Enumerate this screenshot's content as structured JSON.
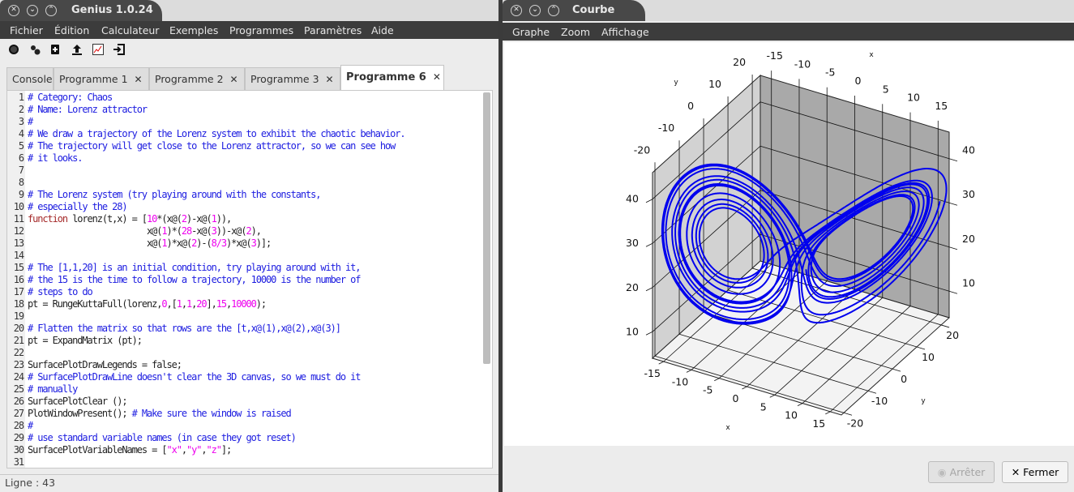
{
  "main_window": {
    "title": "Genius 1.0.24",
    "menu": [
      "Fichier",
      "Édition",
      "Calculateur",
      "Exemples",
      "Programmes",
      "Paramètres",
      "Aide"
    ],
    "toolbar_icons": [
      "stop-icon",
      "run-icon",
      "new-file-icon",
      "upload-icon",
      "plot-icon",
      "exit-icon"
    ],
    "tabs": [
      {
        "label": "Console",
        "closable": false
      },
      {
        "label": "Programme 1",
        "closable": true
      },
      {
        "label": "Programme 2",
        "closable": true
      },
      {
        "label": "Programme 3",
        "closable": true
      },
      {
        "label": "Programme 6",
        "closable": true,
        "active": true
      }
    ],
    "close_glyph": "✕",
    "status": "Ligne : 43"
  },
  "editor": {
    "colors": {
      "comment": "#1c1ce0",
      "keyword": "#a52a2a",
      "number": "#ee00ee",
      "string": "#ee00ee"
    },
    "lines": [
      {
        "n": "1",
        "segs": [
          {
            "k": "c",
            "v": "# Category: Chaos"
          }
        ]
      },
      {
        "n": "2",
        "segs": [
          {
            "k": "c",
            "v": "# Name: Lorenz attractor"
          }
        ]
      },
      {
        "n": "3",
        "segs": [
          {
            "k": "c",
            "v": "#"
          }
        ]
      },
      {
        "n": "4",
        "segs": [
          {
            "k": "c",
            "v": "# We draw a trajectory of the Lorenz system to exhibit the chaotic behavior."
          }
        ]
      },
      {
        "n": "5",
        "segs": [
          {
            "k": "c",
            "v": "# The trajectory will get close to the Lorenz attractor, so we can see how"
          }
        ]
      },
      {
        "n": "6",
        "segs": [
          {
            "k": "c",
            "v": "# it looks."
          }
        ]
      },
      {
        "n": "7",
        "segs": []
      },
      {
        "n": "8",
        "segs": []
      },
      {
        "n": "9",
        "segs": [
          {
            "k": "c",
            "v": "# The Lorenz system (try playing around with the constants,"
          }
        ]
      },
      {
        "n": "10",
        "segs": [
          {
            "k": "c",
            "v": "# especially the 28)"
          }
        ]
      },
      {
        "n": "11",
        "segs": [
          {
            "k": "k",
            "v": "function"
          },
          {
            "k": "t",
            "v": " lorenz(t,x) = ["
          },
          {
            "k": "n",
            "v": "10"
          },
          {
            "k": "t",
            "v": "*(x@("
          },
          {
            "k": "n",
            "v": "2"
          },
          {
            "k": "t",
            "v": ")-x@("
          },
          {
            "k": "n",
            "v": "1"
          },
          {
            "k": "t",
            "v": ")),"
          }
        ]
      },
      {
        "n": "12",
        "segs": [
          {
            "k": "t",
            "v": "                        x@("
          },
          {
            "k": "n",
            "v": "1"
          },
          {
            "k": "t",
            "v": ")*("
          },
          {
            "k": "n",
            "v": "28"
          },
          {
            "k": "t",
            "v": "-x@("
          },
          {
            "k": "n",
            "v": "3"
          },
          {
            "k": "t",
            "v": "))-x@("
          },
          {
            "k": "n",
            "v": "2"
          },
          {
            "k": "t",
            "v": "),"
          }
        ]
      },
      {
        "n": "13",
        "segs": [
          {
            "k": "t",
            "v": "                        x@("
          },
          {
            "k": "n",
            "v": "1"
          },
          {
            "k": "t",
            "v": ")*x@("
          },
          {
            "k": "n",
            "v": "2"
          },
          {
            "k": "t",
            "v": ")-("
          },
          {
            "k": "n",
            "v": "8/3"
          },
          {
            "k": "t",
            "v": ")*x@("
          },
          {
            "k": "n",
            "v": "3"
          },
          {
            "k": "t",
            "v": ")];"
          }
        ]
      },
      {
        "n": "14",
        "segs": []
      },
      {
        "n": "15",
        "segs": [
          {
            "k": "c",
            "v": "# The [1,1,20] is an initial condition, try playing around with it,"
          }
        ]
      },
      {
        "n": "16",
        "segs": [
          {
            "k": "c",
            "v": "# the 15 is the time to follow a trajectory, 10000 is the number of"
          }
        ]
      },
      {
        "n": "17",
        "segs": [
          {
            "k": "c",
            "v": "# steps to do"
          }
        ]
      },
      {
        "n": "18",
        "segs": [
          {
            "k": "t",
            "v": "pt = RungeKuttaFull(lorenz,"
          },
          {
            "k": "n",
            "v": "0"
          },
          {
            "k": "t",
            "v": ",["
          },
          {
            "k": "n",
            "v": "1"
          },
          {
            "k": "t",
            "v": ","
          },
          {
            "k": "n",
            "v": "1"
          },
          {
            "k": "t",
            "v": ","
          },
          {
            "k": "n",
            "v": "20"
          },
          {
            "k": "t",
            "v": "],"
          },
          {
            "k": "n",
            "v": "15"
          },
          {
            "k": "t",
            "v": ","
          },
          {
            "k": "n",
            "v": "10000"
          },
          {
            "k": "t",
            "v": ");"
          }
        ]
      },
      {
        "n": "19",
        "segs": []
      },
      {
        "n": "20",
        "segs": [
          {
            "k": "c",
            "v": "# Flatten the matrix so that rows are the [t,x@(1),x@(2),x@(3)]"
          }
        ]
      },
      {
        "n": "21",
        "segs": [
          {
            "k": "t",
            "v": "pt = ExpandMatrix (pt);"
          }
        ]
      },
      {
        "n": "22",
        "segs": []
      },
      {
        "n": "23",
        "segs": [
          {
            "k": "t",
            "v": "SurfacePlotDrawLegends = false;"
          }
        ]
      },
      {
        "n": "24",
        "segs": [
          {
            "k": "c",
            "v": "# SurfacePlotDrawLine doesn't clear the 3D canvas, so we must do it"
          }
        ]
      },
      {
        "n": "25",
        "segs": [
          {
            "k": "c",
            "v": "# manually"
          }
        ]
      },
      {
        "n": "26",
        "segs": [
          {
            "k": "t",
            "v": "SurfacePlotClear ();"
          }
        ]
      },
      {
        "n": "27",
        "segs": [
          {
            "k": "t",
            "v": "PlotWindowPresent(); "
          },
          {
            "k": "c",
            "v": "# Make sure the window is raised"
          }
        ]
      },
      {
        "n": "28",
        "segs": [
          {
            "k": "c",
            "v": "#"
          }
        ]
      },
      {
        "n": "29",
        "segs": [
          {
            "k": "c",
            "v": "# use standard variable names (in case they got reset)"
          }
        ]
      },
      {
        "n": "30",
        "segs": [
          {
            "k": "t",
            "v": "SurfacePlotVariableNames = ["
          },
          {
            "k": "s",
            "v": "\"x\""
          },
          {
            "k": "t",
            "v": ","
          },
          {
            "k": "s",
            "v": "\"y\""
          },
          {
            "k": "t",
            "v": ","
          },
          {
            "k": "s",
            "v": "\"z\""
          },
          {
            "k": "t",
            "v": "];"
          }
        ]
      },
      {
        "n": "31",
        "segs": []
      }
    ]
  },
  "plot_window": {
    "title": "Courbe",
    "menu": [
      "Graphe",
      "Zoom",
      "Affichage"
    ],
    "stop_label": "Arrêter",
    "close_label": "Fermer",
    "stop_enabled": false
  },
  "chart_data": {
    "type": "line3d",
    "system": "lorenz",
    "parameters": {
      "sigma": 10,
      "rho": 28,
      "beta": "8/3"
    },
    "initial_condition": [
      1,
      1,
      20
    ],
    "t_range": [
      0,
      15
    ],
    "steps": 10000,
    "line_color": "#0000ee",
    "xlabel": "x",
    "ylabel": "y",
    "zlabel": "",
    "xlim": [
      -17,
      17
    ],
    "ylim": [
      -21,
      23.3
    ],
    "zlim": [
      4,
      46
    ],
    "xticks": [
      -15,
      -10,
      -5,
      0,
      5,
      10,
      15
    ],
    "yticks": [
      -20,
      -10,
      0,
      10,
      20
    ],
    "zticks": [
      10,
      20,
      30,
      40
    ],
    "grid": true,
    "wall_colors": {
      "side": "#d2d2d2",
      "back": "#a9a9a9",
      "floor": "#f3f3f3"
    }
  }
}
